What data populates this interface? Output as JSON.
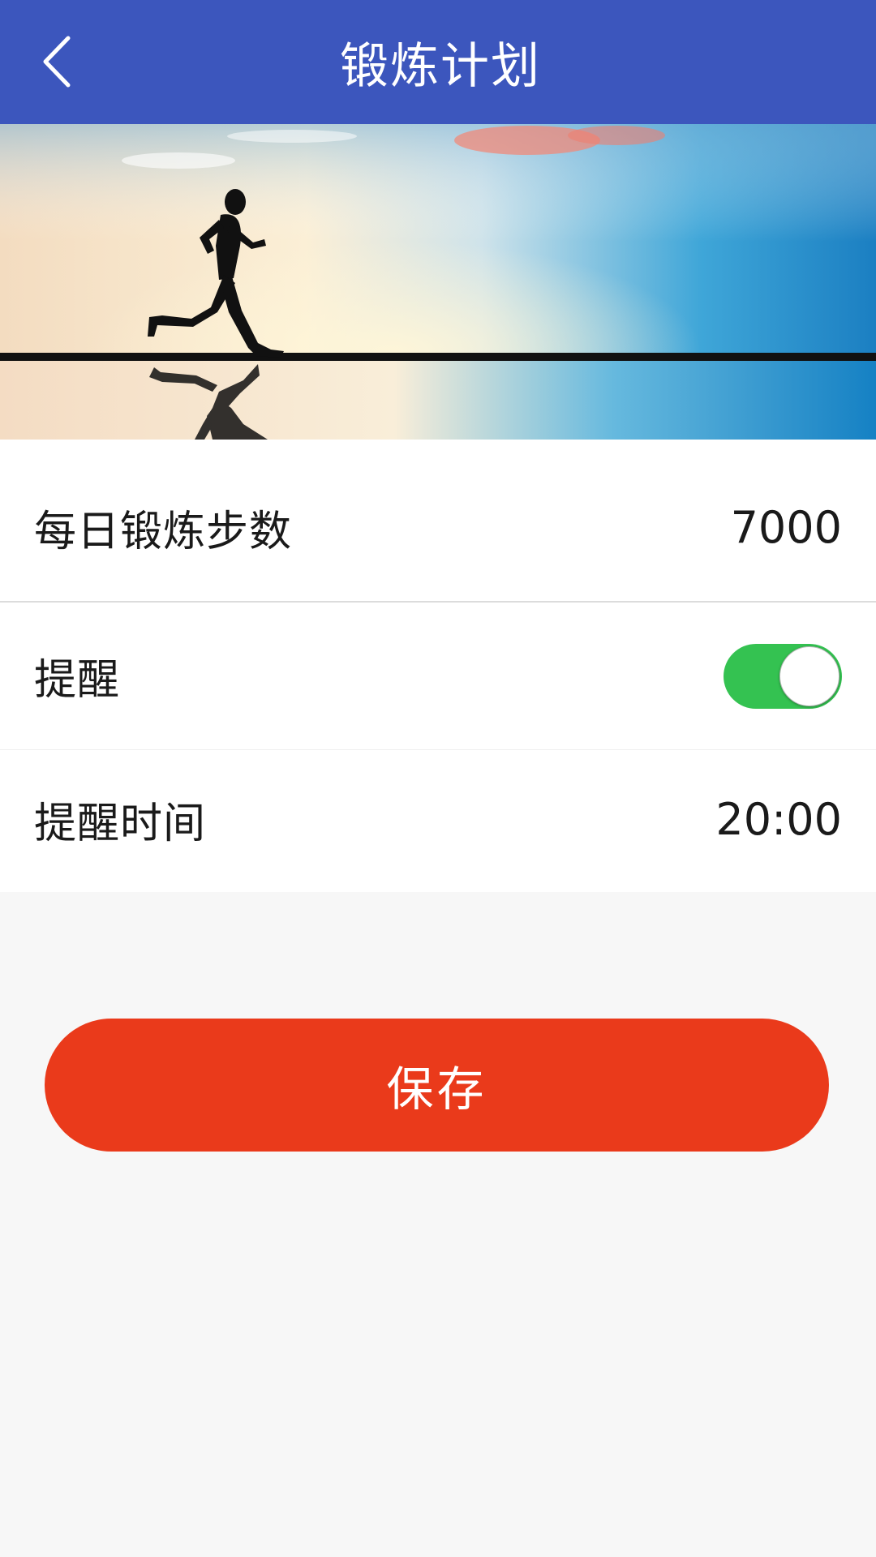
{
  "header": {
    "title": "锻炼计划",
    "back_icon": "chevron-left-icon",
    "color": "#3c56bd"
  },
  "banner": {
    "image": "running-silhouette-sunset-banner"
  },
  "settings": {
    "steps": {
      "label": "每日锻炼步数",
      "value": "7000"
    },
    "reminder": {
      "label": "提醒",
      "enabled": true,
      "toggle_color": "#34c251"
    },
    "reminder_time": {
      "label": "提醒时间",
      "value": "20:00"
    }
  },
  "save_button": {
    "label": "保存",
    "color": "#ea3a1b"
  }
}
